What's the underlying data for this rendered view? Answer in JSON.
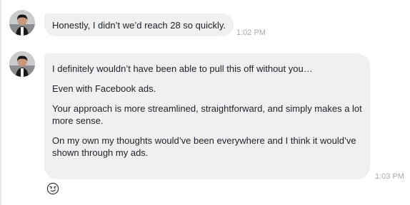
{
  "messages": [
    {
      "text": "Honestly, I didn’t we’d reach 28 so quickly.",
      "time": "1:02 PM"
    },
    {
      "paragraphs": [
        "I definitely wouldn’t have been able to pull this off without you…",
        "Even with Facebook ads.",
        "Your approach is more streamlined, straightforward, and simply makes a lot more sense.",
        "On my own my thoughts would’ve been everywhere and I think it would’ve shown through my ads."
      ],
      "time": "1:03 PM"
    }
  ],
  "icons": {
    "avatar": "user-avatar-photo",
    "reaction": "smirk-emoji-icon"
  },
  "colors": {
    "bubble_bg": "#f1f0f0",
    "text": "#1d2129",
    "timestamp": "#a5a9ae"
  }
}
